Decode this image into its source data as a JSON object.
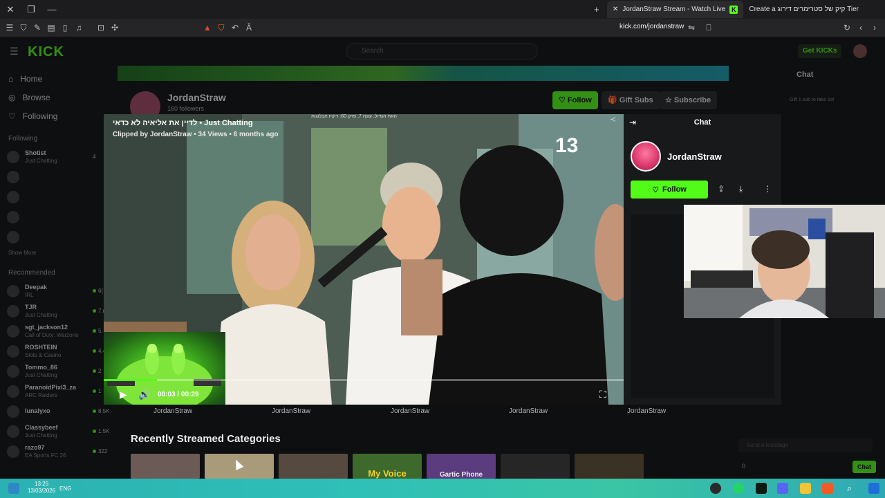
{
  "browser": {
    "tabs": [
      {
        "label": "JordanStraw Stream - Watch Live",
        "active": true
      },
      {
        "label": "Create a קיק של סטרימרים דירוג Tier",
        "active": false
      }
    ],
    "url": "kick.com/jordanstraw"
  },
  "site": {
    "logo": "KICK",
    "search_placeholder": "Search",
    "get_kicks": "Get KICKs",
    "accent": "#53fc18"
  },
  "sidebar": {
    "nav": [
      {
        "label": "Home",
        "icon": "home-icon"
      },
      {
        "label": "Browse",
        "icon": "compass-icon"
      },
      {
        "label": "Following",
        "icon": "heart-icon"
      }
    ],
    "following_heading": "Following",
    "following": [
      {
        "name": "Shotist",
        "sub": "Just Chatting",
        "count": "4"
      },
      {
        "name": "",
        "sub": "",
        "count": ""
      },
      {
        "name": "",
        "sub": "",
        "count": ""
      },
      {
        "name": "",
        "sub": "",
        "count": ""
      },
      {
        "name": "",
        "sub": "",
        "count": ""
      }
    ],
    "show_more": "Show More",
    "recommended_heading": "Recommended",
    "recommended": [
      {
        "name": "Deepak",
        "sub": "IRL",
        "count": "6("
      },
      {
        "name": "TJR",
        "sub": "Just Chatting",
        "count": "7.("
      },
      {
        "name": "sgt_jackson12",
        "sub": "Call of Duty: Warzone",
        "count": "5."
      },
      {
        "name": "ROSHTEIN",
        "sub": "Slots & Casino",
        "count": "4.4"
      },
      {
        "name": "Tommo_86",
        "sub": "Just Chatting",
        "count": "2"
      },
      {
        "name": "ParanoidPixl3_za",
        "sub": "ARC Raiders",
        "count": "1"
      },
      {
        "name": "lunalyxo",
        "sub": "",
        "count": "8.5K"
      },
      {
        "name": "Classybeef",
        "sub": "Just Chatting",
        "count": "1.5K"
      },
      {
        "name": "razo97",
        "sub": "EA Sports FC 26",
        "count": "322"
      }
    ]
  },
  "channel": {
    "name": "JordanStraw",
    "followers": "160 followers",
    "follow_label": "Follow",
    "gift_subs_label": "Gift Subs",
    "subscribe_label": "Subscribe",
    "chat_title": "Chat",
    "chat_gift_text": "Gift 1 sub to take 1st",
    "send_message_placeholder": "Send a message",
    "chat_button": "Chat",
    "chat_points": "0"
  },
  "clip": {
    "title": "לדיין את אליאיה לא כדאי • Just Chatting",
    "meta": "Clipped by JordanStraw • 34 Views • 6 months ago",
    "caption": "האח הגדול, עונה 7, פרק 60: ריטיו הבלוגות",
    "time": "00:03 / 00:29",
    "progress": 0.103,
    "channel_logo": "13"
  },
  "clip_authors": [
    "JordanStraw",
    "JordanStraw",
    "JordanStraw",
    "JordanStraw",
    "JordanStraw"
  ],
  "categories_heading": "Recently Streamed Categories",
  "category_tiles": [
    "",
    "",
    "",
    "My Voice",
    "Gartic Phone",
    "",
    ""
  ],
  "chat_panel": {
    "title": "Chat",
    "streamer": "JordanStraw",
    "follow_label": "Follow"
  },
  "taskbar": {
    "time": "13:25",
    "date": "13/03/2026",
    "lang": "ENG"
  }
}
